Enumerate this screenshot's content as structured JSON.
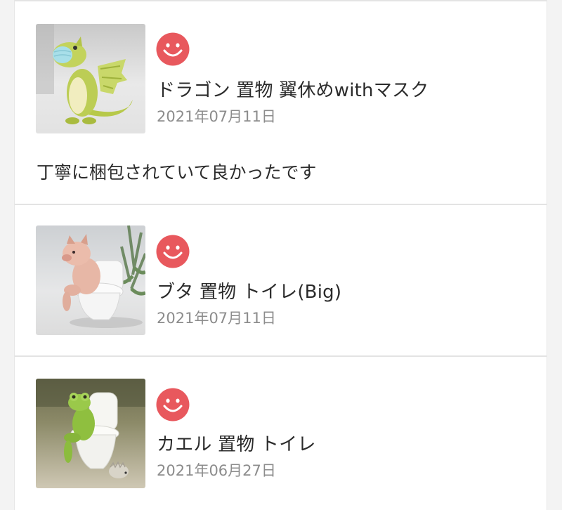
{
  "reviews": [
    {
      "product_image": "dragon-figurine-with-mask",
      "rating_icon": "smiley-face-icon",
      "rating_color": "#e8585d",
      "product_name": "ドラゴン 置物 翼休めwithマスク",
      "date": "2021年07月11日",
      "comment": "丁寧に梱包されていて良かったです"
    },
    {
      "product_image": "pig-on-toilet-figurine",
      "rating_icon": "smiley-face-icon",
      "rating_color": "#e8585d",
      "product_name": "ブタ 置物 トイレ(Big)",
      "date": "2021年07月11日"
    },
    {
      "product_image": "frog-on-toilet-figurine",
      "rating_icon": "smiley-face-icon",
      "rating_color": "#e8585d",
      "product_name": "カエル 置物 トイレ",
      "date": "2021年06月27日"
    }
  ]
}
